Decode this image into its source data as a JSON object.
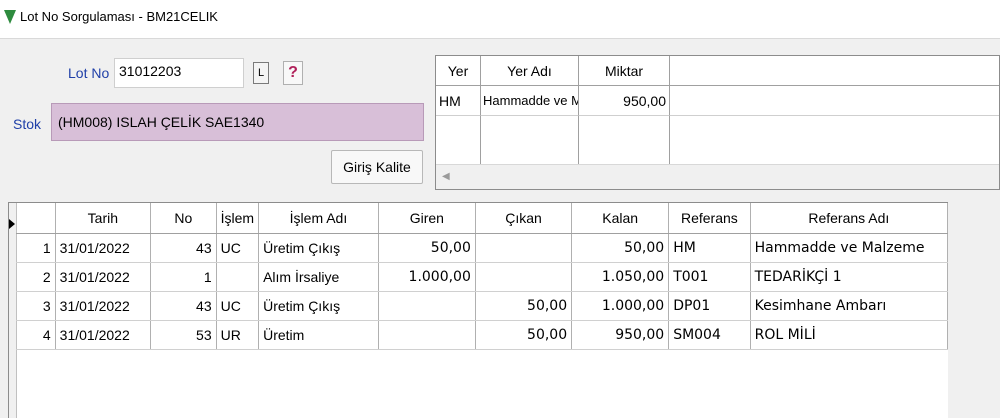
{
  "window": {
    "title": "Lot No Sorgulaması - BM21CELIK"
  },
  "colors": {
    "stok_bg": "#d8bfd8",
    "label_blue": "#1f3fa8",
    "app_icon_green": "#2e8b3e"
  },
  "form": {
    "lot_label": "Lot No",
    "lot_value": "31012203",
    "l_button": "L",
    "help_button": "?",
    "stok_label": "Stok",
    "stok_value": "(HM008) ISLAH ÇELİK SAE1340",
    "giris_kalite_button": "Giriş Kalite"
  },
  "location_grid": {
    "headers": [
      "Yer",
      "Yer Adı",
      "Miktar"
    ],
    "rows": [
      {
        "yer": "HM",
        "yer_adi": "Hammadde ve M",
        "miktar": "950,00"
      }
    ]
  },
  "movements_grid": {
    "headers": [
      "",
      "Tarih",
      "No",
      "İşlem",
      "İşlem Adı",
      "Giren",
      "Çıkan",
      "Kalan",
      "Referans",
      "Referans Adı"
    ],
    "rows": [
      {
        "idx": "1",
        "tarih": "31/01/2022",
        "no": "43",
        "islem": "UC",
        "islem_adi": "Üretim Çıkış",
        "giren": "50,00",
        "cikan": "",
        "kalan": "50,00",
        "referans": "HM",
        "referans_adi": "Hammadde ve Malzeme"
      },
      {
        "idx": "2",
        "tarih": "31/01/2022",
        "no": "1",
        "islem": "",
        "islem_adi": "Alım İrsaliye",
        "giren": "1.000,00",
        "cikan": "",
        "kalan": "1.050,00",
        "referans": "T001",
        "referans_adi": "TEDARİKÇİ 1"
      },
      {
        "idx": "3",
        "tarih": "31/01/2022",
        "no": "43",
        "islem": "UC",
        "islem_adi": "Üretim Çıkış",
        "giren": "",
        "cikan": "50,00",
        "kalan": "1.000,00",
        "referans": "DP01",
        "referans_adi": "Kesimhane Ambarı"
      },
      {
        "idx": "4",
        "tarih": "31/01/2022",
        "no": "53",
        "islem": "UR",
        "islem_adi": "Üretim",
        "giren": "",
        "cikan": "50,00",
        "kalan": "950,00",
        "referans": "SM004",
        "referans_adi": "ROL MİLİ"
      }
    ]
  }
}
